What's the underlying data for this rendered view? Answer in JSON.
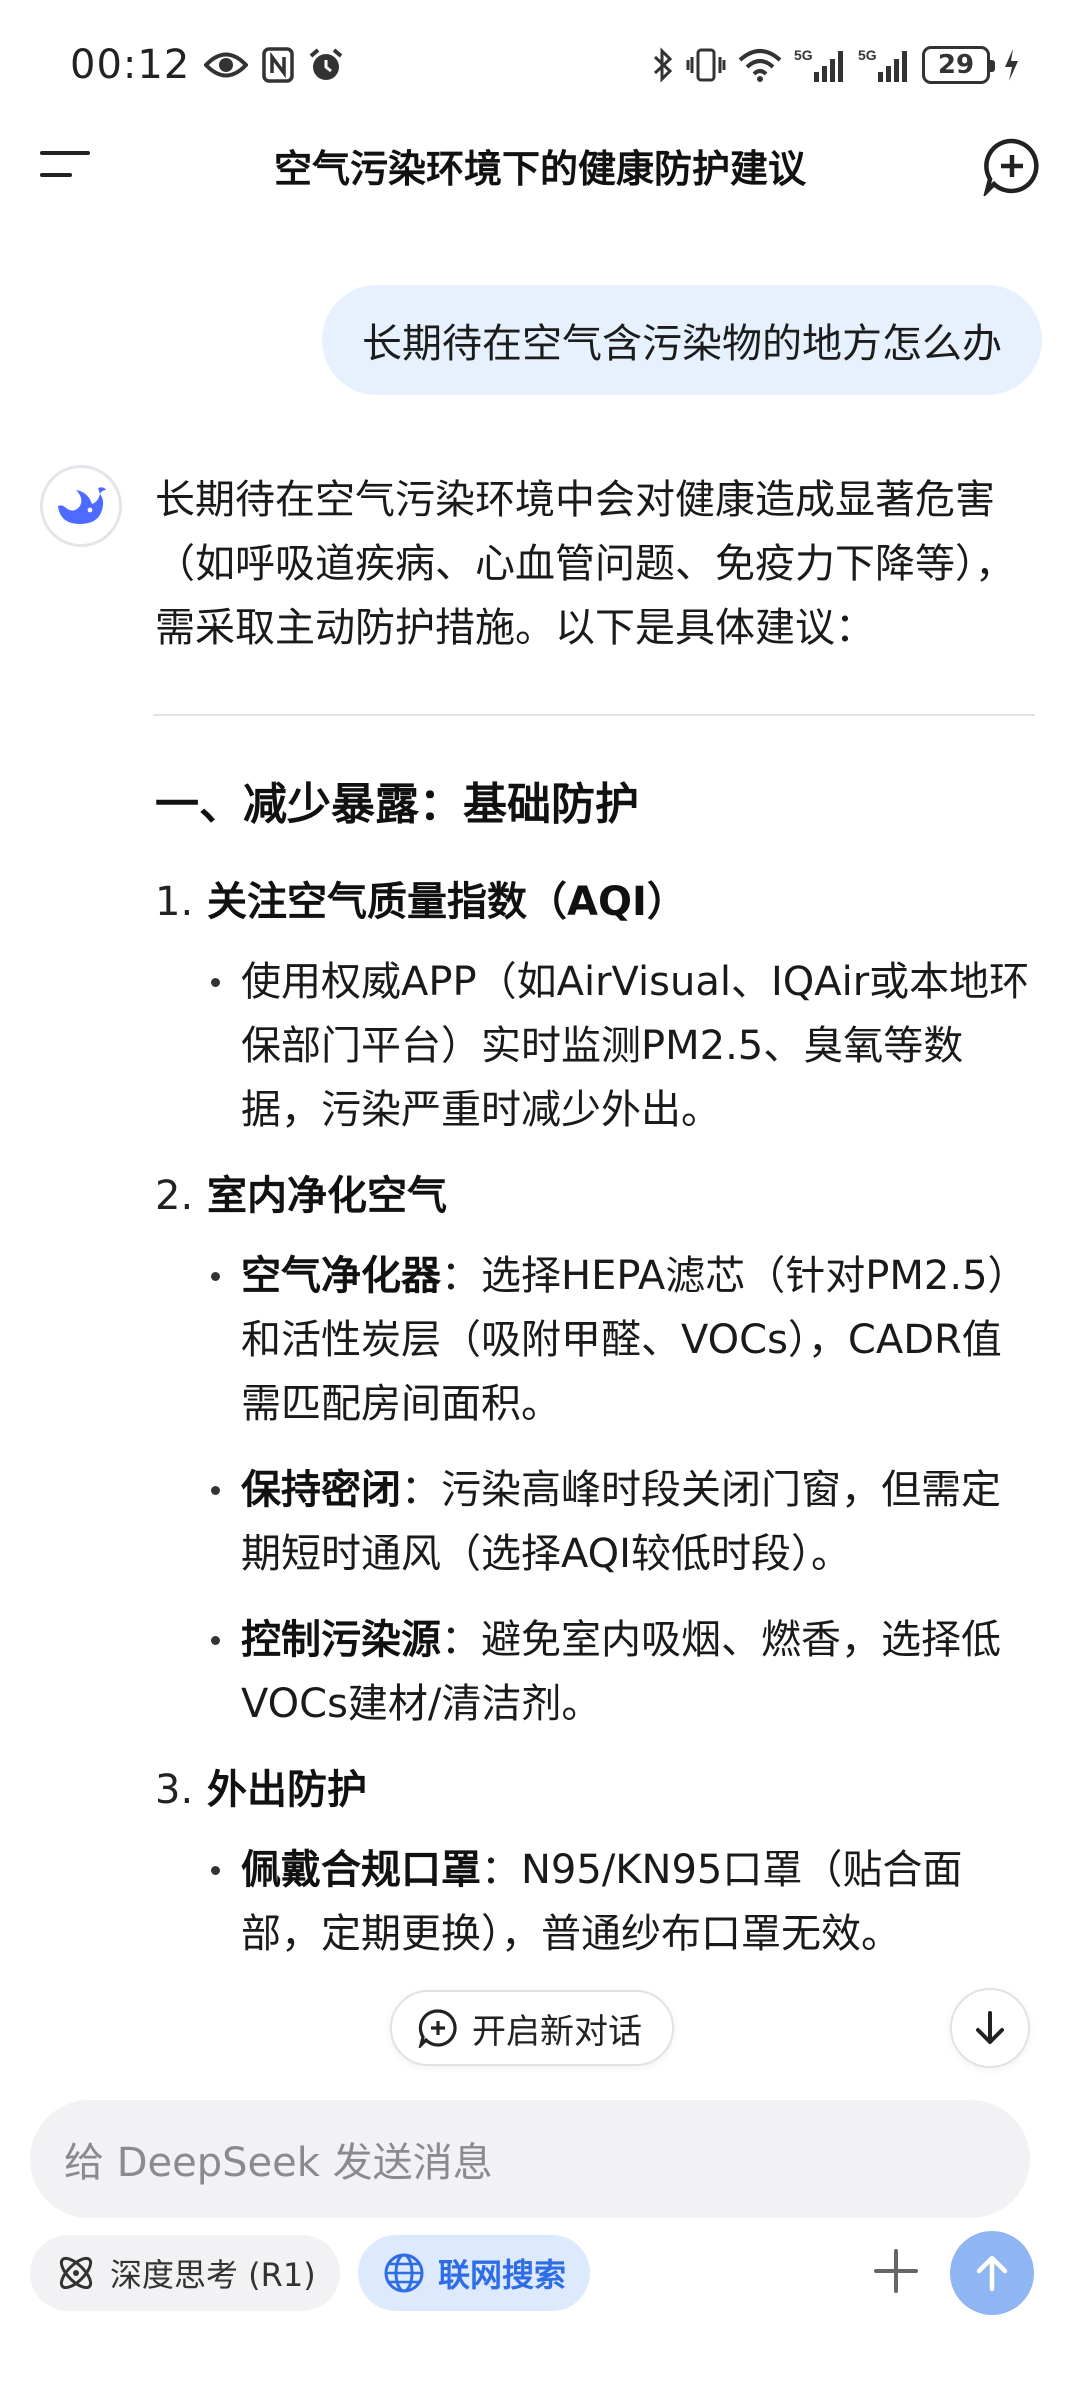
{
  "status_bar": {
    "time": "00:12",
    "battery": "29",
    "network_1": "5G",
    "network_2": "5G"
  },
  "header": {
    "title": "空气污染环境下的健康防护建议"
  },
  "user_message": "长期待在空气含污染物的地方怎么办",
  "answer": {
    "intro": "长期待在空气污染环境中会对健康造成显著危害（如呼吸道疾病、心血管问题、免疫力下降等），需采取主动防护措施。以下是具体建议：",
    "section_title": "一、减少暴露：基础防护",
    "items": [
      {
        "num": "1.",
        "title": "关注空气质量指数（AQI）",
        "bullets": [
          {
            "label": "",
            "text": "使用权威APP（如AirVisual、IQAir或本地环保部门平台）实时监测PM2.5、臭氧等数据，污染严重时减少外出。"
          }
        ]
      },
      {
        "num": "2.",
        "title": "室内净化空气",
        "bullets": [
          {
            "label": "空气净化器",
            "text": "：选择HEPA滤芯（针对PM2.5）和活性炭层（吸附甲醛、VOCs），CADR值需匹配房间面积。"
          },
          {
            "label": "保持密闭",
            "text": "：污染高峰时段关闭门窗，但需定期短时通风（选择AQI较低时段）。"
          },
          {
            "label": "控制污染源",
            "text": "：避免室内吸烟、燃香，选择低VOCs建材/清洁剂。"
          }
        ]
      },
      {
        "num": "3.",
        "title": "外出防护",
        "bullets": [
          {
            "label": "佩戴合规口罩",
            "text": "：N95/KN95口罩（贴合面部，定期更换），普通纱布口罩无效。"
          }
        ]
      }
    ]
  },
  "new_chat_label": "开启新对话",
  "input": {
    "placeholder": "给 DeepSeek 发送消息"
  },
  "toolbar": {
    "deep_think_label": "深度思考 (R1)",
    "web_search_label": "联网搜索"
  },
  "colors": {
    "accent": "#2f6de6",
    "user_bubble": "#e7f0fd",
    "send_button": "#8fb5f2"
  }
}
